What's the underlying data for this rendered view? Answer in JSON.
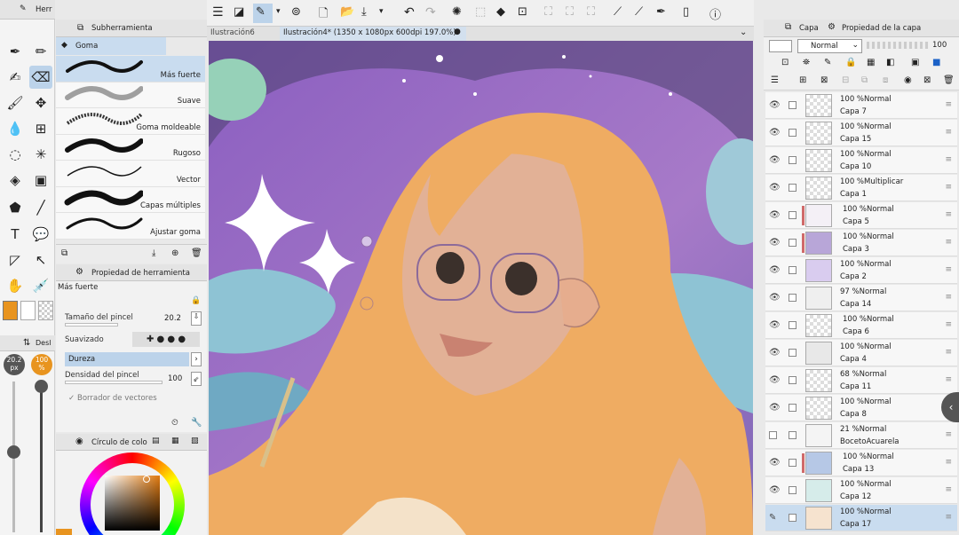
{
  "tools_panel": {
    "tab_label": "Herr"
  },
  "subtool": {
    "tab_label": "Subherramienta",
    "group": "Goma",
    "brushes": [
      {
        "label": "Más fuerte"
      },
      {
        "label": "Suave"
      },
      {
        "label": "Goma moldeable"
      },
      {
        "label": "Rugoso"
      },
      {
        "label": "Vector"
      },
      {
        "label": "Capas múltiples"
      },
      {
        "label": "Ajustar goma"
      }
    ]
  },
  "tool_property": {
    "title": "Propiedad de herramienta",
    "preset_name": "Más fuerte",
    "brush_size_label": "Tamaño del pincel",
    "brush_size_value": "20.2",
    "smoothing_label": "Suavizado",
    "hardness_label": "Dureza",
    "density_label": "Densidad del pincel",
    "density_value": "100",
    "vector_eraser_label": "Borrador de vectores"
  },
  "size_slider": {
    "tab_label": "Desl",
    "size_value": "20.2",
    "size_unit": "px",
    "opacity_value": "100",
    "opacity_unit": "%"
  },
  "color_panel": {
    "title": "Círculo de colo",
    "main_color": "#e8941f"
  },
  "document_tabs": [
    {
      "label": "Ilustración6"
    },
    {
      "label": "Ilustración4* (1350 x 1080px 600dpi 197.0%)"
    }
  ],
  "layers_panel": {
    "tab_layer": "Capa",
    "tab_props": "Propiedad de la capa",
    "blend_mode": "Normal",
    "opacity": "100",
    "layers": [
      {
        "mode": "100 %Normal",
        "name": "Capa 7"
      },
      {
        "mode": "100 %Normal",
        "name": "Capa 15"
      },
      {
        "mode": "100 %Normal",
        "name": "Capa 10"
      },
      {
        "mode": "100 %Multiplicar",
        "name": "Capa 1"
      },
      {
        "mode": "100 %Normal",
        "name": "Capa 5"
      },
      {
        "mode": "100 %Normal",
        "name": "Capa 3"
      },
      {
        "mode": "100 %Normal",
        "name": "Capa 2"
      },
      {
        "mode": "97 %Normal",
        "name": "Capa 14"
      },
      {
        "mode": "100 %Normal",
        "name": "Capa 6"
      },
      {
        "mode": "100 %Normal",
        "name": "Capa 4"
      },
      {
        "mode": "68 %Normal",
        "name": "Capa 11"
      },
      {
        "mode": "100 %Normal",
        "name": "Capa 8"
      },
      {
        "mode": "21 %Normal",
        "name": "BocetoAcuarela"
      },
      {
        "mode": "100 %Normal",
        "name": "Capa 13"
      },
      {
        "mode": "100 %Normal",
        "name": "Capa 12"
      },
      {
        "mode": "100 %Normal",
        "name": "Capa 17"
      }
    ]
  },
  "colors": {
    "accent": "#e8941f",
    "selection": "#c9dcef"
  }
}
